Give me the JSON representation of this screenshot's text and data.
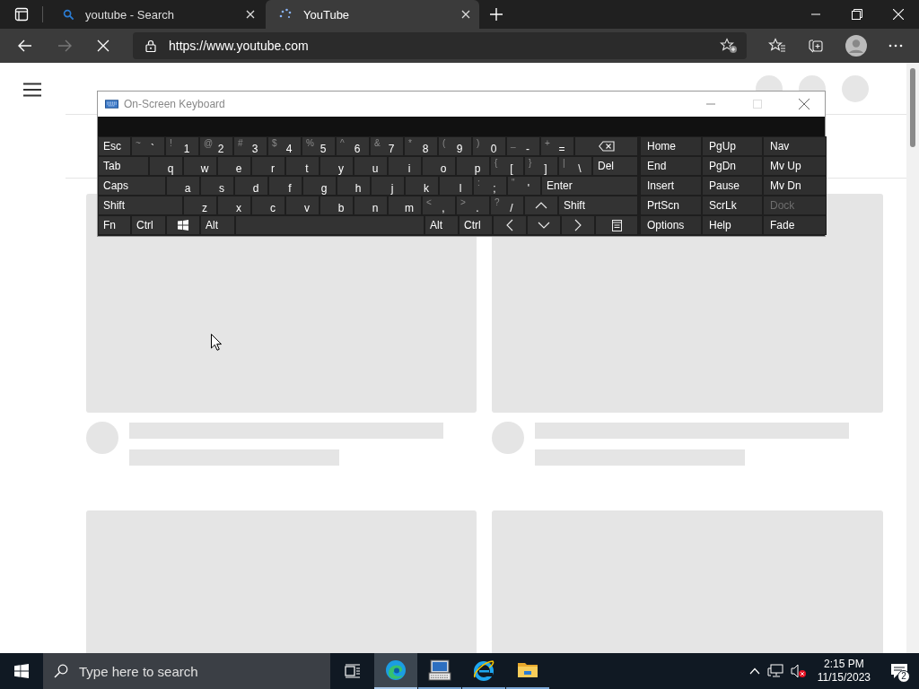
{
  "browser": {
    "tabs": [
      {
        "title": "youtube - Search",
        "selected": false,
        "kind": "search"
      },
      {
        "title": "YouTube",
        "selected": true,
        "kind": "loading"
      }
    ],
    "toolbar": {
      "forward_disabled": true,
      "loading": true
    },
    "address": {
      "url": "https://www.youtube.com"
    }
  },
  "osk": {
    "title": "On-Screen Keyboard",
    "maximize_disabled": true,
    "rows": [
      {
        "keys": [
          {
            "kind": "text",
            "label": "Esc"
          },
          {
            "kind": "char",
            "shift": "~",
            "label": "`"
          },
          {
            "kind": "char",
            "shift": "!",
            "label": "1"
          },
          {
            "kind": "char",
            "shift": "@",
            "label": "2"
          },
          {
            "kind": "char",
            "shift": "#",
            "label": "3"
          },
          {
            "kind": "char",
            "shift": "$",
            "label": "4"
          },
          {
            "kind": "char",
            "shift": "%",
            "label": "5"
          },
          {
            "kind": "char",
            "shift": "^",
            "label": "6"
          },
          {
            "kind": "char",
            "shift": "&",
            "label": "7"
          },
          {
            "kind": "char",
            "shift": "*",
            "label": "8"
          },
          {
            "kind": "char",
            "shift": "(",
            "label": "9"
          },
          {
            "kind": "char",
            "shift": ")",
            "label": "0"
          },
          {
            "kind": "char",
            "shift": "_",
            "label": "-"
          },
          {
            "kind": "char",
            "shift": "+",
            "label": "="
          },
          {
            "kind": "backspace"
          }
        ]
      },
      {
        "keys": [
          {
            "kind": "text",
            "label": "Tab"
          },
          {
            "kind": "char",
            "label": "q"
          },
          {
            "kind": "char",
            "label": "w"
          },
          {
            "kind": "char",
            "label": "e"
          },
          {
            "kind": "char",
            "label": "r"
          },
          {
            "kind": "char",
            "label": "t"
          },
          {
            "kind": "char",
            "label": "y"
          },
          {
            "kind": "char",
            "label": "u"
          },
          {
            "kind": "char",
            "label": "i"
          },
          {
            "kind": "char",
            "label": "o"
          },
          {
            "kind": "char",
            "label": "p"
          },
          {
            "kind": "char",
            "shift": "{",
            "label": "["
          },
          {
            "kind": "char",
            "shift": "}",
            "label": "]"
          },
          {
            "kind": "char",
            "shift": "|",
            "label": "\\"
          },
          {
            "kind": "text",
            "label": "Del"
          }
        ]
      },
      {
        "keys": [
          {
            "kind": "text",
            "label": "Caps"
          },
          {
            "kind": "char",
            "label": "a"
          },
          {
            "kind": "char",
            "label": "s"
          },
          {
            "kind": "char",
            "label": "d"
          },
          {
            "kind": "char",
            "label": "f"
          },
          {
            "kind": "char",
            "label": "g"
          },
          {
            "kind": "char",
            "label": "h"
          },
          {
            "kind": "char",
            "label": "j"
          },
          {
            "kind": "char",
            "label": "k"
          },
          {
            "kind": "char",
            "label": "l"
          },
          {
            "kind": "char",
            "shift": ":",
            "label": ";"
          },
          {
            "kind": "char",
            "shift": "\"",
            "label": "'"
          },
          {
            "kind": "text",
            "label": "Enter"
          }
        ]
      },
      {
        "keys": [
          {
            "kind": "text",
            "label": "Shift"
          },
          {
            "kind": "char",
            "label": "z"
          },
          {
            "kind": "char",
            "label": "x"
          },
          {
            "kind": "char",
            "label": "c"
          },
          {
            "kind": "char",
            "label": "v"
          },
          {
            "kind": "char",
            "label": "b"
          },
          {
            "kind": "char",
            "label": "n"
          },
          {
            "kind": "char",
            "label": "m"
          },
          {
            "kind": "char",
            "shift": "<",
            "label": ","
          },
          {
            "kind": "char",
            "shift": ">",
            "label": "."
          },
          {
            "kind": "char",
            "shift": "?",
            "label": "/"
          },
          {
            "kind": "up"
          },
          {
            "kind": "text",
            "label": "Shift"
          }
        ]
      },
      {
        "keys": [
          {
            "kind": "text",
            "label": "Fn"
          },
          {
            "kind": "text",
            "label": "Ctrl"
          },
          {
            "kind": "windows"
          },
          {
            "kind": "text",
            "label": "Alt"
          },
          {
            "kind": "space"
          },
          {
            "kind": "text",
            "label": "Alt"
          },
          {
            "kind": "text",
            "label": "Ctrl"
          },
          {
            "kind": "left"
          },
          {
            "kind": "down"
          },
          {
            "kind": "right"
          },
          {
            "kind": "menu"
          }
        ]
      }
    ],
    "side_rows": [
      [
        {
          "label": "Home",
          "disabled": false
        },
        {
          "label": "PgUp",
          "disabled": false
        },
        {
          "label": "Nav",
          "disabled": false
        }
      ],
      [
        {
          "label": "End",
          "disabled": false
        },
        {
          "label": "PgDn",
          "disabled": false
        },
        {
          "label": "Mv Up",
          "disabled": false
        }
      ],
      [
        {
          "label": "Insert",
          "disabled": false
        },
        {
          "label": "Pause",
          "disabled": false
        },
        {
          "label": "Mv Dn",
          "disabled": false
        }
      ],
      [
        {
          "label": "PrtScn",
          "disabled": false
        },
        {
          "label": "ScrLk",
          "disabled": false
        },
        {
          "label": "Dock",
          "disabled": true
        }
      ],
      [
        {
          "label": "Options",
          "disabled": false
        },
        {
          "label": "Help",
          "disabled": false
        },
        {
          "label": "Fade",
          "disabled": false
        }
      ]
    ]
  },
  "taskbar": {
    "search": {
      "placeholder": "Type here to search"
    },
    "apps": [
      {
        "kind": "edge",
        "active": true
      },
      {
        "kind": "keyboard",
        "active": false
      },
      {
        "kind": "ie",
        "active": false
      },
      {
        "kind": "folder",
        "active": false
      }
    ],
    "time": "2:15 PM",
    "date": "11/15/2023",
    "notifications": "2"
  }
}
